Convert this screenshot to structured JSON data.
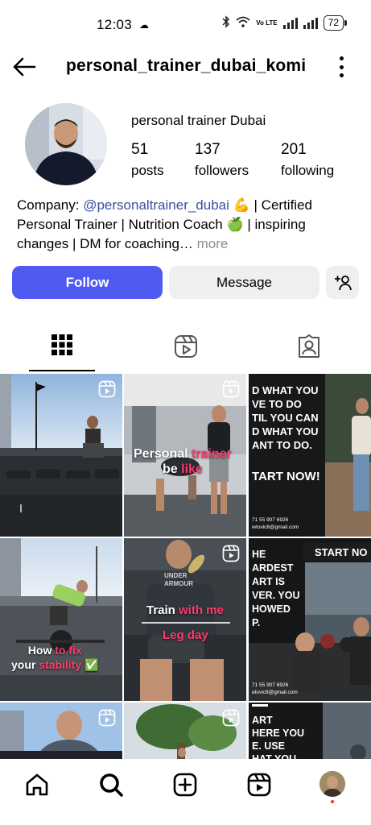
{
  "status_bar": {
    "time": "12:03",
    "battery": "72",
    "volte": "Vo LTE"
  },
  "header": {
    "username": "personal_trainer_dubai_komi"
  },
  "profile": {
    "full_name": "personal trainer Dubai",
    "stats": [
      {
        "value": "51",
        "label": "posts"
      },
      {
        "value": "137",
        "label": "followers"
      },
      {
        "value": "201",
        "label": "following"
      }
    ],
    "bio": {
      "prefix": "Company: ",
      "mention": "@personaltrainer_dubai",
      "line1_rest": " 💪 | Certified",
      "line2": "Personal Trainer | Nutrition Coach 🍏 | inspiring",
      "line3": "changes | DM for coaching…",
      "more": " more"
    }
  },
  "actions": {
    "follow": "Follow",
    "message": "Message"
  },
  "tabs": [
    "grid-icon",
    "reels-icon",
    "tagged-icon"
  ],
  "posts": {
    "p2": {
      "line1a": "Personal ",
      "line1b": "trainer",
      "line2a": "be ",
      "line2b": "like"
    },
    "p3": {
      "lines": [
        "D WHAT YOU",
        "VE TO DO",
        "TIL YOU CAN",
        "D WHAT YOU",
        "ANT TO DO."
      ],
      "cta": "TART NOW!",
      "phone": "71 55 907 6926",
      "email": "ietovic8@gmail.com"
    },
    "p4": {
      "line1a": "How ",
      "line1b": "to fix",
      "line2a": "your ",
      "line2b": "stability",
      "check": "✅"
    },
    "p5": {
      "line1a": "Train ",
      "line1b": "with me",
      "line2": "Leg day",
      "shirt": "UNDER ARMOUR"
    },
    "p6": {
      "badge": "START NO",
      "lines": [
        "HE",
        "ARDEST",
        "ART IS",
        "VER. YOU",
        "HOWED",
        "P."
      ],
      "phone": "71 55 907 6926",
      "email": "etovic8@gmail.com"
    },
    "p9": {
      "lines": [
        "ART",
        "HERE YOU",
        "E. USE",
        "HAT YOU"
      ]
    }
  },
  "bottom_nav": [
    "home-icon",
    "search-icon",
    "create-icon",
    "reels-icon",
    "profile-avatar"
  ],
  "colors": {
    "follow_bg": "#4f5bf0",
    "mention": "#3a4fa3",
    "highlight": "#ff3b6b"
  }
}
